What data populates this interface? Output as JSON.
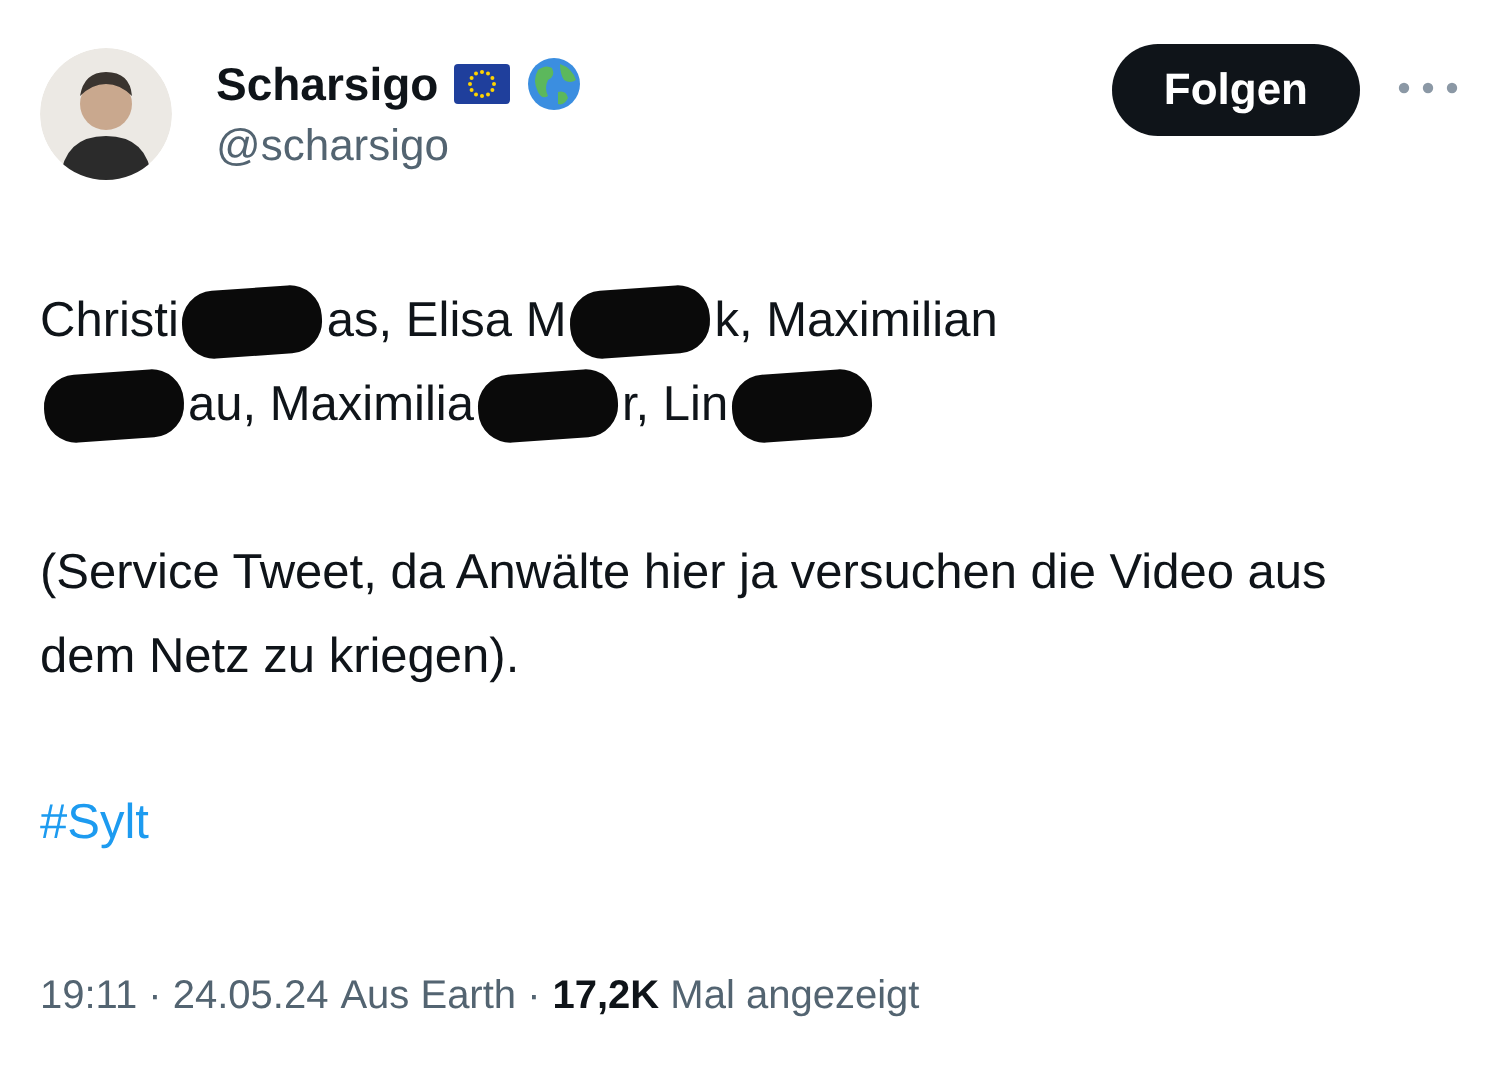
{
  "author": {
    "name": "Scharsigo",
    "handle": "@scharsigo"
  },
  "follow_button": {
    "label": "Folgen"
  },
  "tweet_lines": [
    [
      {
        "kind": "text",
        "text": "Christi"
      },
      {
        "kind": "redaction"
      },
      {
        "kind": "text",
        "text": "as, Elisa M"
      },
      {
        "kind": "redaction"
      },
      {
        "kind": "text",
        "text": "k, Maximilian"
      }
    ],
    [
      {
        "kind": "redaction"
      },
      {
        "kind": "text",
        "text": "au, Maximilia"
      },
      {
        "kind": "redaction"
      },
      {
        "kind": "text",
        "text": "r, Lin"
      },
      {
        "kind": "redaction"
      }
    ]
  ],
  "paragraph": "(Service Tweet, da Anwälte hier ja versuchen die Video aus dem Netz zu kriegen).",
  "hashtag": "#Sylt",
  "meta": {
    "time": "19:11 · 24.05.24",
    "source": "Aus Earth ·",
    "views": "17,2K",
    "views_label": "Mal angezeigt"
  }
}
